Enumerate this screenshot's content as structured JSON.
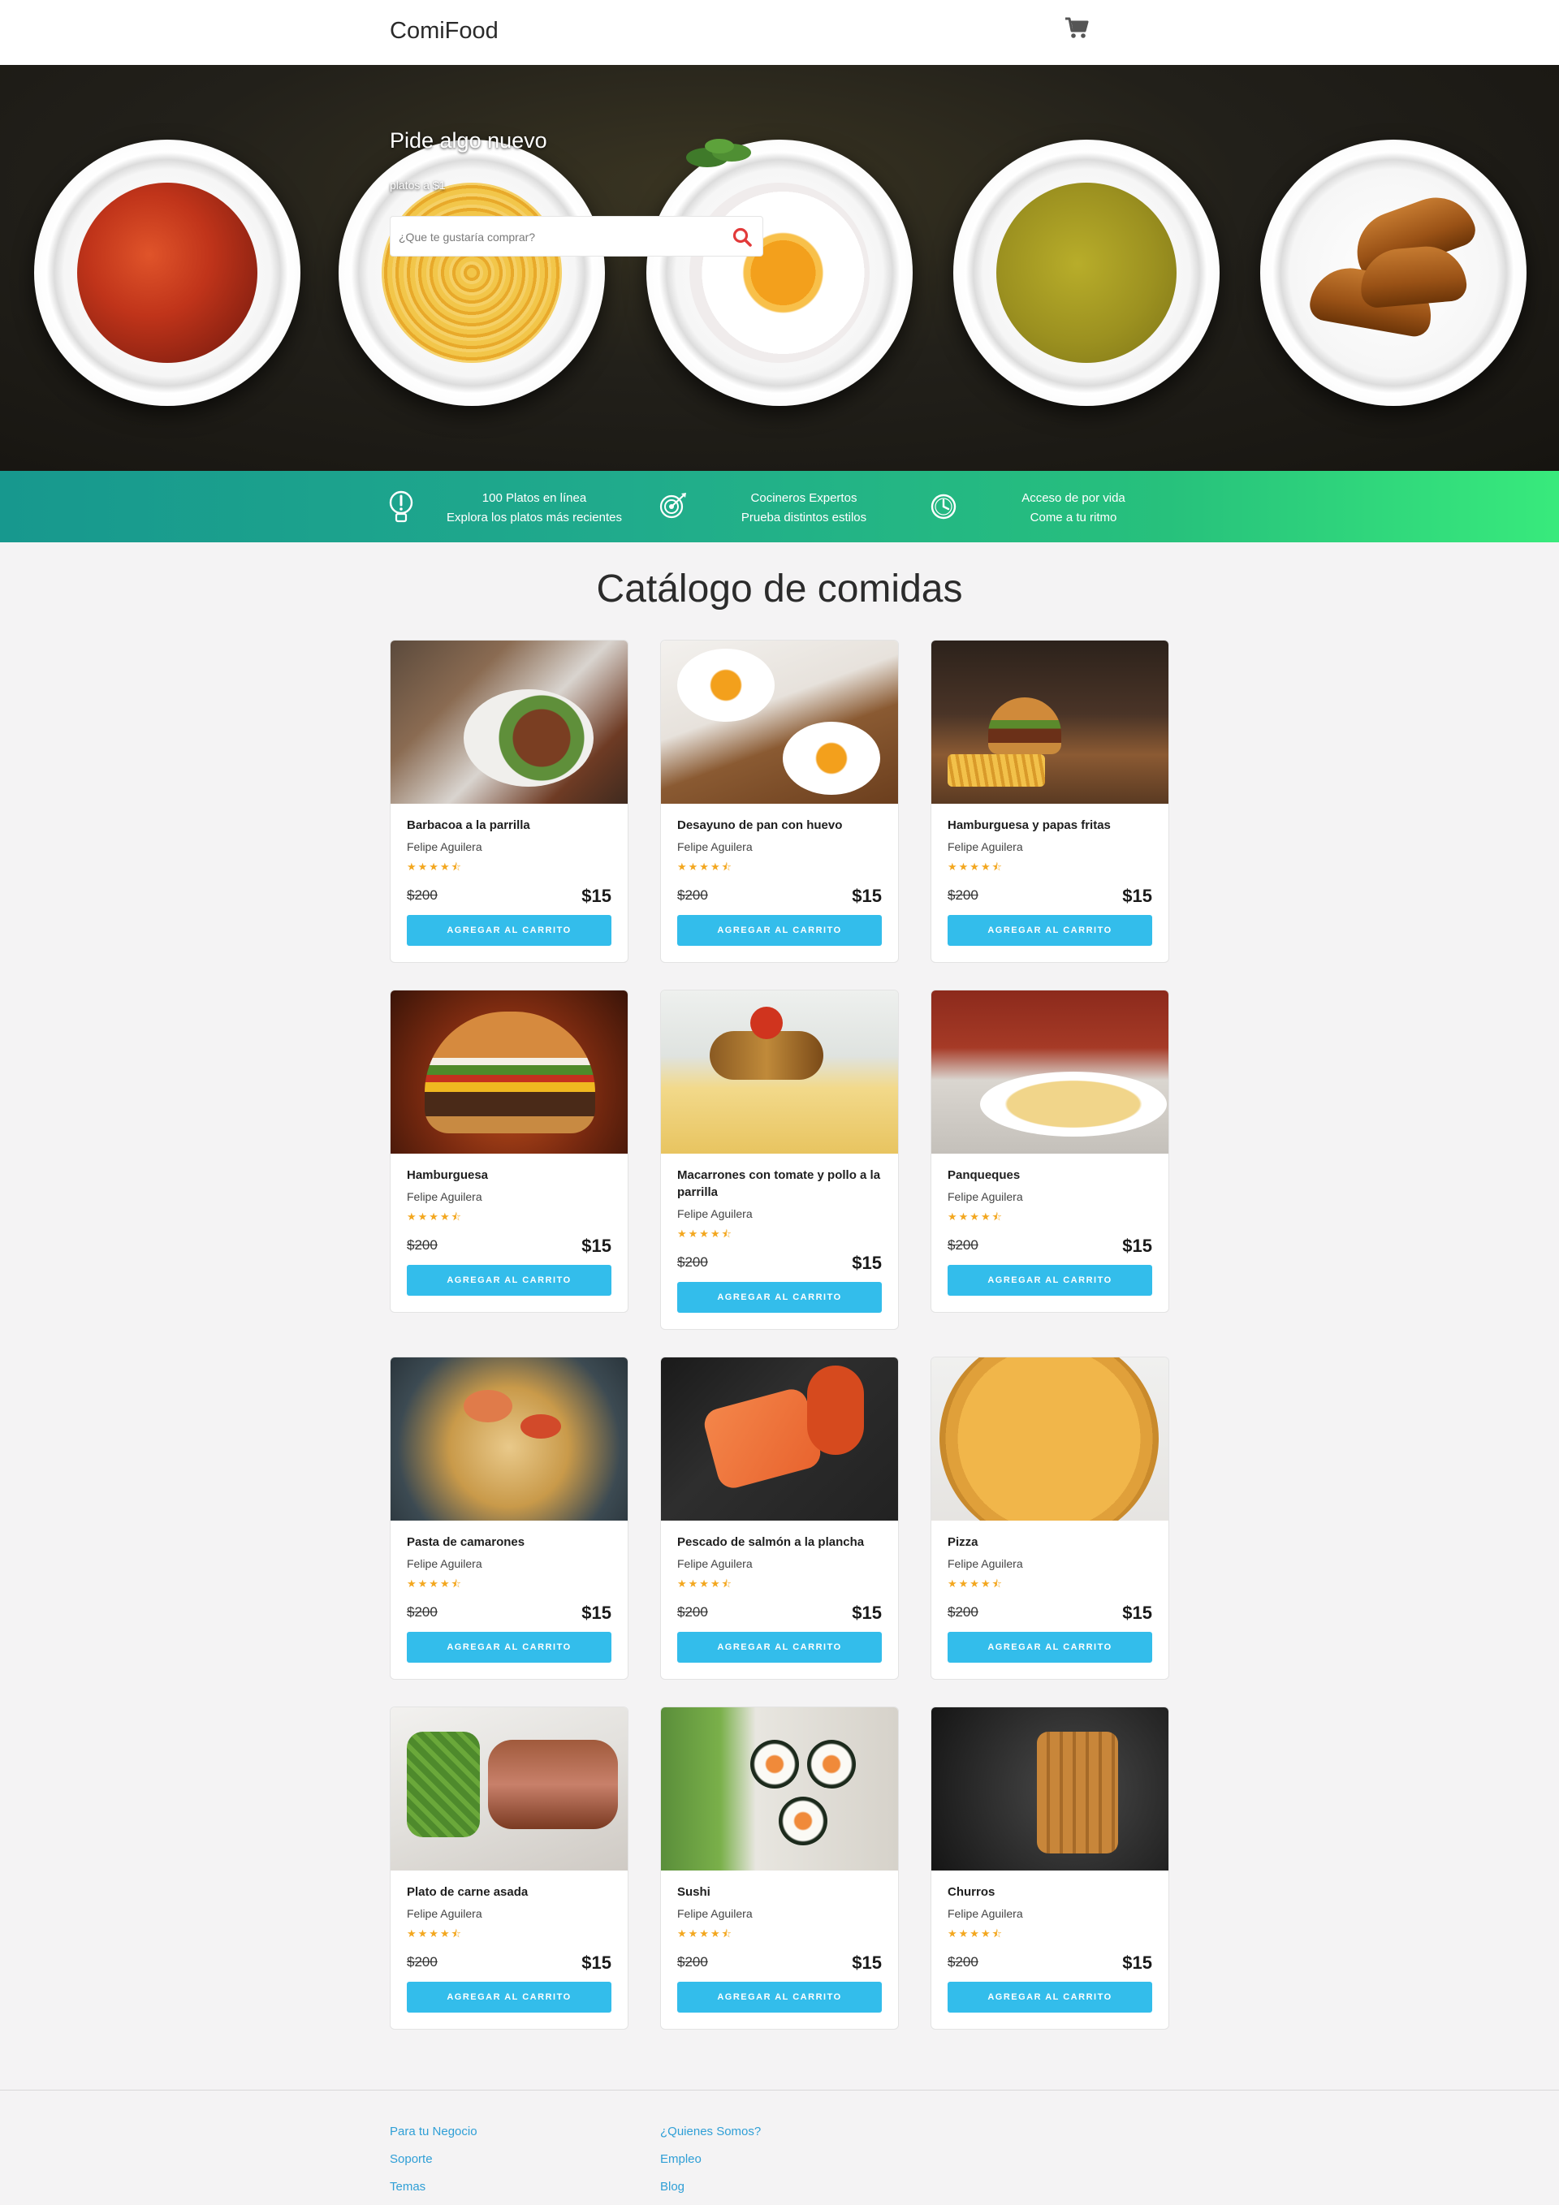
{
  "brand": "ComiFood",
  "nav": {
    "cart_icon": "shopping-cart-icon"
  },
  "hero": {
    "title": "Pide algo nuevo",
    "subtitle": "platos a $1",
    "search_placeholder": "¿Que te gustaría comprar?",
    "search_icon": "search-icon"
  },
  "features": [
    {
      "icon": "lightbulb-icon",
      "line1": "100 Platos en línea",
      "line2": "Explora los platos más recientes"
    },
    {
      "icon": "target-icon",
      "line1": "Cocineros Expertos",
      "line2": "Prueba distintos estilos"
    },
    {
      "icon": "clock-icon",
      "line1": "Acceso de por vida",
      "line2": "Come a tu ritmo"
    }
  ],
  "catalog": {
    "title": "Catálogo de comidas",
    "rating": 4.5,
    "items": [
      {
        "name": "Barbacoa a la parrilla",
        "author": "Felipe Aguilera",
        "stars": "★★★★⯪",
        "old_price": "$200",
        "price": "$15",
        "button": "AGREGAR AL CARRITO"
      },
      {
        "name": "Desayuno de pan con huevo",
        "author": "Felipe Aguilera",
        "stars": "★★★★⯪",
        "old_price": "$200",
        "price": "$15",
        "button": "AGREGAR AL CARRITO"
      },
      {
        "name": "Hamburguesa y papas fritas",
        "author": "Felipe Aguilera",
        "stars": "★★★★⯪",
        "old_price": "$200",
        "price": "$15",
        "button": "AGREGAR AL CARRITO"
      },
      {
        "name": "Hamburguesa",
        "author": "Felipe Aguilera",
        "stars": "★★★★⯪",
        "old_price": "$200",
        "price": "$15",
        "button": "AGREGAR AL CARRITO"
      },
      {
        "name": "Macarrones con tomate y pollo a la parrilla",
        "author": "Felipe Aguilera",
        "stars": "★★★★⯪",
        "old_price": "$200",
        "price": "$15",
        "button": "AGREGAR AL CARRITO"
      },
      {
        "name": "Panqueques",
        "author": "Felipe Aguilera",
        "stars": "★★★★⯪",
        "old_price": "$200",
        "price": "$15",
        "button": "AGREGAR AL CARRITO"
      },
      {
        "name": "Pasta de camarones",
        "author": "Felipe Aguilera",
        "stars": "★★★★⯪",
        "old_price": "$200",
        "price": "$15",
        "button": "AGREGAR AL CARRITO"
      },
      {
        "name": "Pescado de salmón a la plancha",
        "author": "Felipe Aguilera",
        "stars": "★★★★⯪",
        "old_price": "$200",
        "price": "$15",
        "button": "AGREGAR AL CARRITO"
      },
      {
        "name": "Pizza",
        "author": "Felipe Aguilera",
        "stars": "★★★★⯪",
        "old_price": "$200",
        "price": "$15",
        "button": "AGREGAR AL CARRITO"
      },
      {
        "name": "Plato de carne asada",
        "author": "Felipe Aguilera",
        "stars": "★★★★⯪",
        "old_price": "$200",
        "price": "$15",
        "button": "AGREGAR AL CARRITO"
      },
      {
        "name": "Sushi",
        "author": "Felipe Aguilera",
        "stars": "★★★★⯪",
        "old_price": "$200",
        "price": "$15",
        "button": "AGREGAR AL CARRITO"
      },
      {
        "name": "Churros",
        "author": "Felipe Aguilera",
        "stars": "★★★★⯪",
        "old_price": "$200",
        "price": "$15",
        "button": "AGREGAR AL CARRITO"
      }
    ]
  },
  "footer": {
    "col1": [
      "Para tu Negocio",
      "Soporte",
      "Temas"
    ],
    "col2": [
      "¿Quienes Somos?",
      "Empleo",
      "Blog"
    ]
  },
  "colors": {
    "accent_button": "#33bdeb",
    "star": "#f3a71f",
    "link": "#2f9fd6",
    "strip_start": "#17988e",
    "strip_end": "#38ea7c"
  }
}
